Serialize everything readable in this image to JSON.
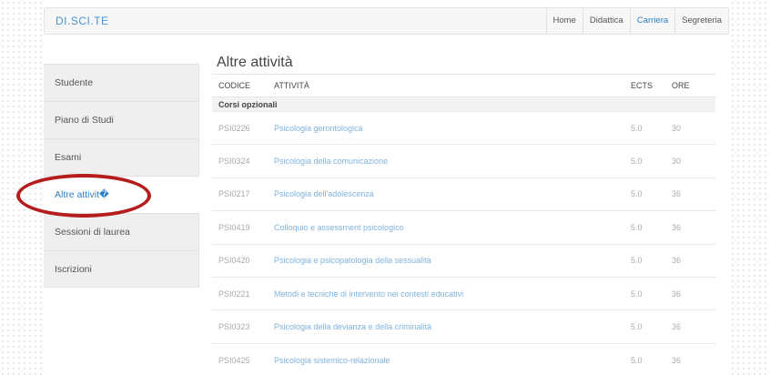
{
  "brand": "DI.SCI.TE",
  "nav": [
    {
      "label": "Home",
      "active": false
    },
    {
      "label": "Didattica",
      "active": false
    },
    {
      "label": "Carriera",
      "active": true
    },
    {
      "label": "Segreteria",
      "active": false
    }
  ],
  "sidebar": {
    "items": [
      {
        "label": "Studente",
        "active": false
      },
      {
        "label": "Piano di Studi",
        "active": false
      },
      {
        "label": "Esami",
        "active": false
      },
      {
        "label": "Altre attivit�",
        "active": true
      },
      {
        "label": "Sessioni di laurea",
        "active": false
      },
      {
        "label": "Iscrizioni",
        "active": false
      }
    ]
  },
  "main": {
    "title": "Altre attività",
    "columns": {
      "code": "CODICE",
      "activity": "ATTIVITÀ",
      "ects": "ECTS",
      "hours": "ORE"
    },
    "group": "Corsi opzionali",
    "rows": [
      {
        "code": "PSI0226",
        "activity": "Psicologia gerontologica",
        "ects": "5.0",
        "hours": "30"
      },
      {
        "code": "PSI0324",
        "activity": "Psicologia della comunicazione",
        "ects": "5.0",
        "hours": "30"
      },
      {
        "code": "PSI0217",
        "activity": "Psicologia dell'adolescenza",
        "ects": "5.0",
        "hours": "36"
      },
      {
        "code": "PSI0419",
        "activity": "Colloquio e assessment psicologico",
        "ects": "5.0",
        "hours": "36"
      },
      {
        "code": "PSI0420",
        "activity": "Psicologia e psicopatologia della sessualità",
        "ects": "5.0",
        "hours": "36"
      },
      {
        "code": "PSI0221",
        "activity": "Metodi e tecniche di intervento nei contesti educativi",
        "ects": "5.0",
        "hours": "36"
      },
      {
        "code": "PSI0323",
        "activity": "Psicologia della devianza e della criminalità",
        "ects": "5.0",
        "hours": "36"
      },
      {
        "code": "PSI0425",
        "activity": "Psicologia sistemico-relazionale",
        "ects": "5.0",
        "hours": "36"
      }
    ]
  },
  "colors": {
    "accent": "#2a7fc6",
    "link": "#7fb3dd",
    "annotation": "#b51c1c"
  }
}
